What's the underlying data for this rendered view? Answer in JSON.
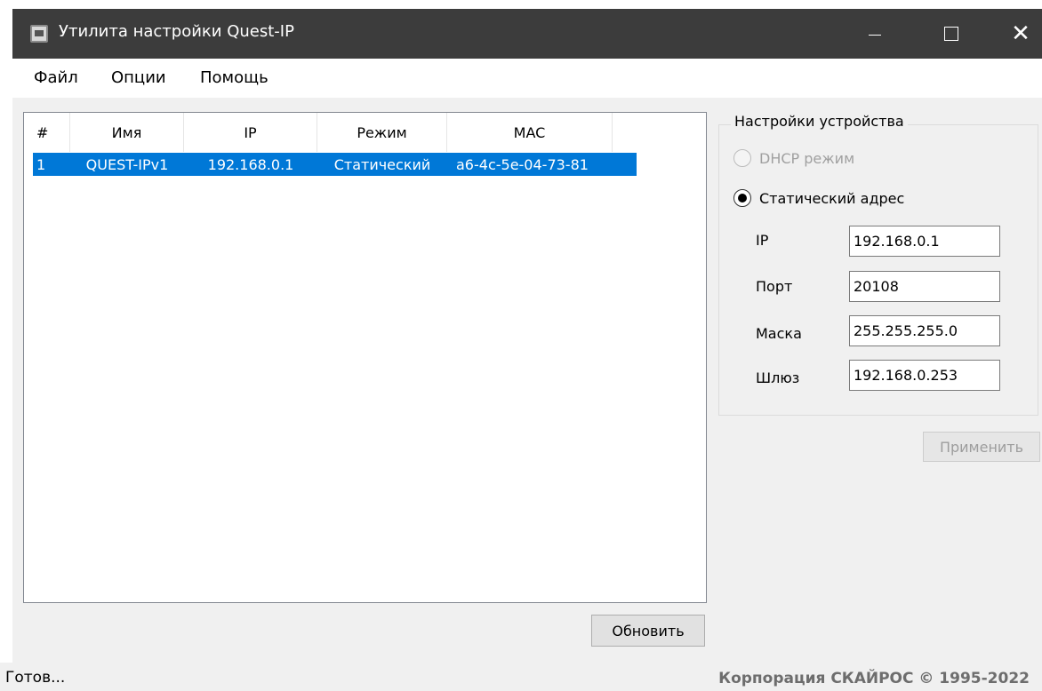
{
  "window": {
    "title": "Утилита настройки Quest-IP",
    "icon": "app-icon",
    "controls": {
      "minimize": "minimize-icon",
      "maximize": "maximize-icon",
      "close": "✕"
    }
  },
  "menu": {
    "items": [
      {
        "label": "Файл"
      },
      {
        "label": "Опции"
      },
      {
        "label": "Помощь"
      }
    ]
  },
  "device_list": {
    "columns": [
      "#",
      "Имя",
      "IP",
      "Режим",
      "MAC"
    ],
    "rows": [
      {
        "num": "1",
        "name": "QUEST-IPv1",
        "ip": "192.168.0.1",
        "mode": "Статический",
        "mac": "a6-4c-5e-04-73-81",
        "selected": true
      }
    ],
    "refresh_label": "Обновить",
    "selection_color": "#0078d7"
  },
  "device_settings": {
    "group_title": "Настройки устройства",
    "dhcp_label": "DHCP режим",
    "static_label": "Статический адрес",
    "ip_label": "IP",
    "ip_value": "192.168.0.1",
    "port_label": "Порт",
    "port_value": "20108",
    "mask_label": "Маска",
    "mask_value": "255.255.255.0",
    "gateway_label": "Шлюз",
    "gateway_value": "192.168.0.253",
    "apply_label": "Применить"
  },
  "status": {
    "text": "Готов...",
    "copyright": "Корпорация СКАЙРОС © 1995-2022"
  }
}
